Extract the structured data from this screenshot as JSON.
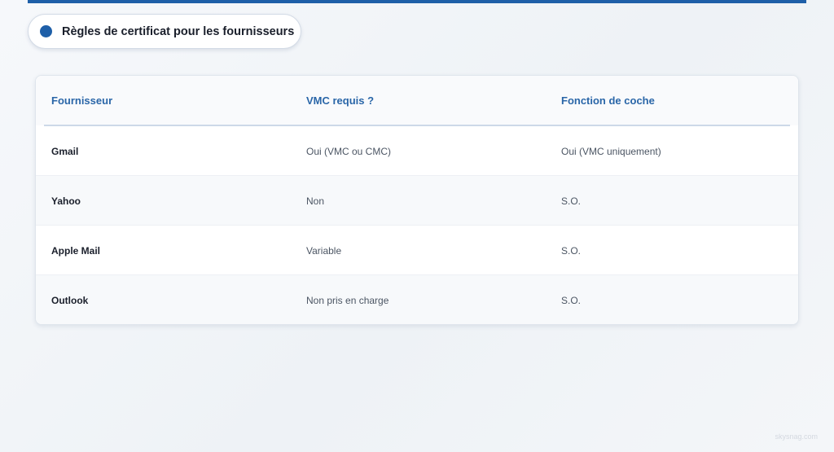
{
  "accent_color": "#1e5fa8",
  "header": {
    "title": "Règles de certificat pour les fournisseurs"
  },
  "table": {
    "columns": [
      "Fournisseur",
      "VMC requis ?",
      "Fonction de coche"
    ],
    "rows": [
      [
        "Gmail",
        "Oui (VMC ou CMC)",
        "Oui (VMC uniquement)"
      ],
      [
        "Yahoo",
        "Non",
        "S.O."
      ],
      [
        "Apple Mail",
        "Variable",
        "S.O."
      ],
      [
        "Outlook",
        "Non pris en charge",
        "S.O."
      ]
    ]
  },
  "watermark": "skysnag.com"
}
